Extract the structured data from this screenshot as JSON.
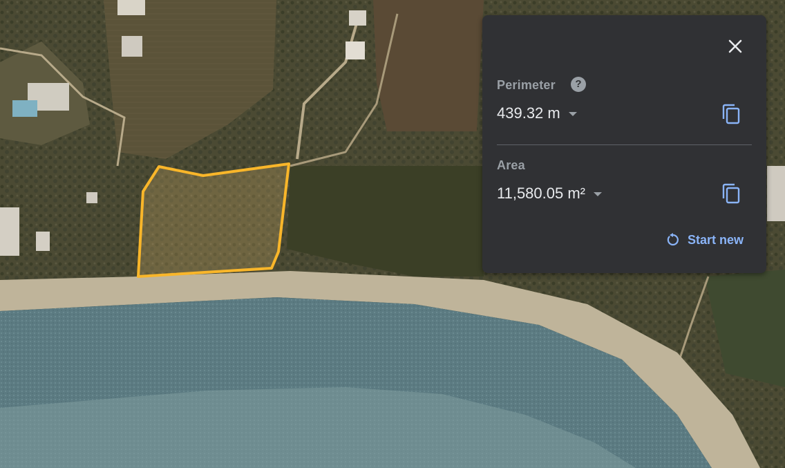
{
  "map": {
    "polygon_color": "#f9b62a",
    "sea_color": "#5f7f86",
    "land_color": "#4a4c33"
  },
  "measure": {
    "perimeter_label": "Perimeter",
    "perimeter_value": "439.32 m",
    "area_label": "Area",
    "area_value": "11,580.05 m²",
    "start_new_label": "Start new",
    "help_symbol": "?"
  },
  "icons": {
    "close": "close-icon",
    "help": "help-icon",
    "copy": "copy-icon",
    "dropdown": "caret-down-icon",
    "restart": "restart-icon"
  },
  "colors": {
    "panel_bg": "#303134",
    "accent": "#8ab4f8",
    "text": "#e8eaed",
    "muted": "#9aa0a6"
  }
}
